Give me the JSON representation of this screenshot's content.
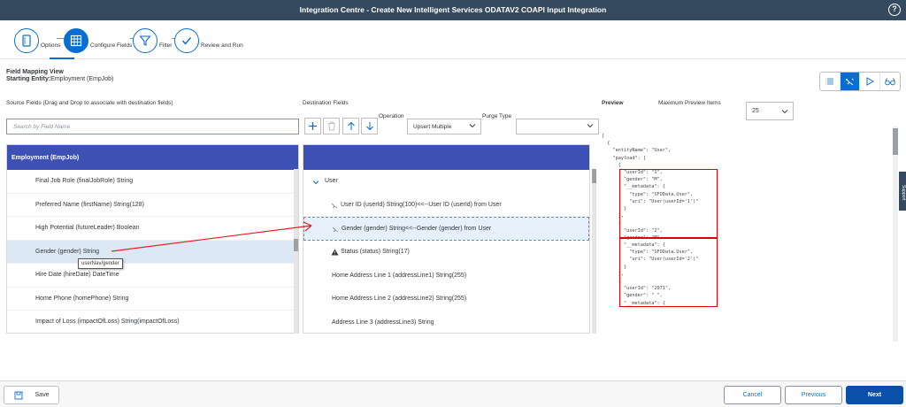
{
  "shell": {
    "title": "Integration Centre - Create New Intelligent Services ODATAV2 COAPI Input Integration"
  },
  "wizard": {
    "steps": [
      {
        "label": "Options"
      },
      {
        "label": "Configure Fields"
      },
      {
        "label": "Filter"
      },
      {
        "label": "Review and Run"
      }
    ]
  },
  "mapping": {
    "title": "Field Mapping View",
    "starting_entity_label": "Starting Entity:",
    "starting_entity_value": "Employment (EmpJob)"
  },
  "columns": {
    "source_label": "Source Fields (Drag and Drop to associate with destination fields)",
    "destination_label": "Destination Fields",
    "preview_label": "Preview",
    "max_preview_label": "Maximum Preview Items"
  },
  "search": {
    "placeholder": "Search by Field Name"
  },
  "operation": {
    "label": "Operation",
    "value": "Upsert Multiple"
  },
  "purge": {
    "label": "Purge Type",
    "value": ""
  },
  "max_preview": {
    "value": "25"
  },
  "source": {
    "header": "Employment (EmpJob)",
    "rows": [
      "Final Job Role (finalJobRole) String",
      "Preferred Name (firstName) String(128)",
      "High Potential (futureLeader) Boolean",
      "Gender (gender) String",
      "Hire Date (hireDate) DateTime",
      "Home Phone (homePhone) String",
      "Impact of Loss (impactOfLoss) String(impactOfLoss)"
    ]
  },
  "tooltip": "userNav/gender",
  "destination": {
    "header": "",
    "root": "User",
    "rows": [
      "User ID (userId) String(100)<<--User ID (userId) from User",
      "Gender (gender) String<<--Gender (gender) from User",
      "Status (status) String(17)",
      "Home Address Line 1 (addressLine1) String(255)",
      "Home Address Line 2 (addressLine2) String(255)",
      "Address Line 3 (addressLine3) String"
    ]
  },
  "preview": {
    "code": "[\n  {\n    \"entityName\": \"User\",\n    \"payload\": [\n      {\n        \"userId\": \"1\",\n        \"gender\": \"M\",\n        \"__metadata\": {\n          \"type\": \"SFOData.User\",\n          \"uri\": \"User(userId='1')\"\n        }\n      },\n      {\n        \"userId\": \"2\",\n        \"gender\": \"M\",\n        \"__metadata\": {\n          \"type\": \"SFOData.User\",\n          \"uri\": \"User(userId='2')\"\n        }\n      },\n      {\n        \"userId\": \"2071\",\n        \"gender\": \" \",\n        \"__metadata\": {"
  },
  "side_tab": "Support",
  "footer": {
    "save": "Save",
    "cancel": "Cancel",
    "previous": "Previous",
    "next": "Next"
  },
  "colors": {
    "shell": "#354a5f",
    "accent": "#0a6ed1",
    "panel_header": "#3d51b5",
    "highlight": "#dd0000"
  }
}
